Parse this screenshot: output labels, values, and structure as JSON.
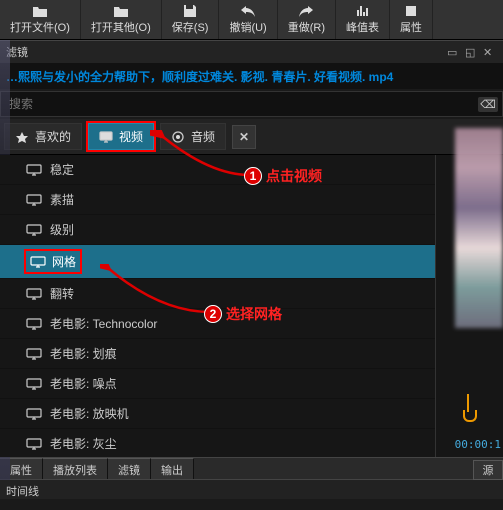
{
  "toolbar": [
    {
      "label": "打开文件(O)",
      "icon": "folder"
    },
    {
      "label": "打开其他(O)",
      "icon": "folder"
    },
    {
      "label": "保存(S)",
      "icon": "save"
    },
    {
      "label": "撤销(U)",
      "icon": "undo"
    },
    {
      "label": "重做(R)",
      "icon": "redo"
    },
    {
      "label": "峰值表",
      "icon": "peak"
    },
    {
      "label": "属性",
      "icon": "props"
    }
  ],
  "panel_title": "滤镜",
  "file_title": "…熙熙与发小的全力帮助下，顺利度过难关. 影视. 青春片. 好看视频. mp4",
  "search": {
    "placeholder": "搜索",
    "clear": "⌫"
  },
  "tabs": {
    "fav": {
      "label": "喜欢的",
      "icon": "star"
    },
    "video": {
      "label": "视频",
      "icon": "monitor"
    },
    "audio": {
      "label": "音频",
      "icon": "record"
    },
    "close": "✕"
  },
  "effects": [
    {
      "label": "稳定"
    },
    {
      "label": "素描"
    },
    {
      "label": "级别"
    },
    {
      "label": "网格",
      "selected": true,
      "boxed": true
    },
    {
      "label": "翻转"
    },
    {
      "label": "老电影: Technocolor"
    },
    {
      "label": "老电影: 划痕"
    },
    {
      "label": "老电影: 噪点"
    },
    {
      "label": "老电影: 放映机"
    },
    {
      "label": "老电影: 灰尘"
    }
  ],
  "bottom_tabs": [
    "属性",
    "播放列表",
    "滤镜",
    "输出"
  ],
  "timeline_label": "时间线",
  "source_btn": "源",
  "timecode": "00:00:1",
  "annotations": {
    "a1": {
      "num": "1",
      "text": "点击视频"
    },
    "a2": {
      "num": "2",
      "text": "选择网格"
    }
  }
}
